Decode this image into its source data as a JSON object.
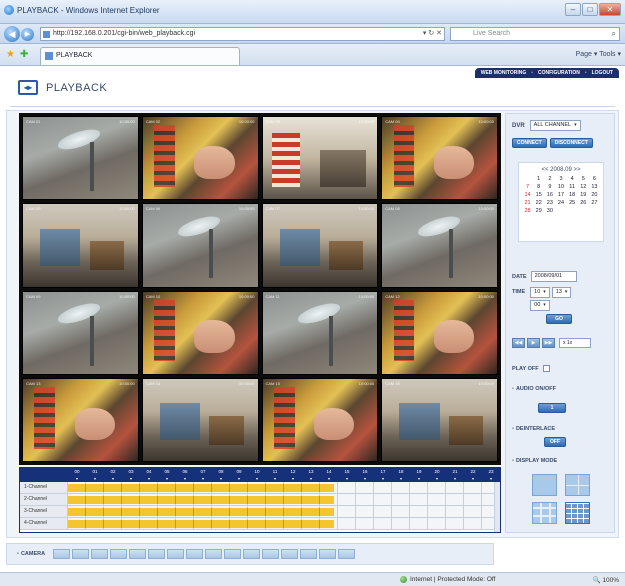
{
  "browser": {
    "window_title": "PLAYBACK - Windows Internet Explorer",
    "url": "http://192.168.0.201/cgi-bin/web_playback.cgi",
    "search_placeholder": "Live Search",
    "tab_title": "PLAYBACK",
    "tools": "Page ▾  Tools ▾",
    "status_zone": "Internet | Protected Mode: Off",
    "zoom": "100%"
  },
  "app": {
    "page_title": "PLAYBACK",
    "nav": [
      "WEB MONITORING",
      "CONFIGURATION",
      "LOGOUT"
    ]
  },
  "cameras": [
    {
      "label": "CAM 01",
      "time": "10:00:00",
      "scene": "street"
    },
    {
      "label": "CAM 02",
      "time": "10:00:00",
      "scene": "object"
    },
    {
      "label": "CAM 03",
      "time": "10:00:00",
      "scene": "store"
    },
    {
      "label": "CAM 04",
      "time": "10:00:00",
      "scene": "object"
    },
    {
      "label": "CAM 05",
      "time": "10:00:00",
      "scene": "room"
    },
    {
      "label": "CAM 06",
      "time": "10:00:00",
      "scene": "street"
    },
    {
      "label": "CAM 07",
      "time": "10:00:00",
      "scene": "room"
    },
    {
      "label": "CAM 08",
      "time": "10:00:00",
      "scene": "street"
    },
    {
      "label": "CAM 09",
      "time": "10:00:00",
      "scene": "street"
    },
    {
      "label": "CAM 10",
      "time": "10:00:00",
      "scene": "object"
    },
    {
      "label": "CAM 11",
      "time": "10:00:00",
      "scene": "street"
    },
    {
      "label": "CAM 12",
      "time": "10:00:00",
      "scene": "object"
    },
    {
      "label": "CAM 13",
      "time": "10:00:00",
      "scene": "object"
    },
    {
      "label": "CAM 14",
      "time": "10:00:00",
      "scene": "room"
    },
    {
      "label": "CAM 15",
      "time": "10:00:00",
      "scene": "object"
    },
    {
      "label": "CAM 16",
      "time": "10:00:00",
      "scene": "room"
    }
  ],
  "timeline": {
    "hours": [
      "00",
      "01",
      "02",
      "03",
      "04",
      "05",
      "06",
      "07",
      "08",
      "09",
      "10",
      "11",
      "12",
      "13",
      "14",
      "15",
      "16",
      "17",
      "18",
      "19",
      "20",
      "21",
      "22",
      "23"
    ],
    "channels": [
      {
        "name": "1-Channel",
        "recorded_fraction": 0.625
      },
      {
        "name": "2-Channel",
        "recorded_fraction": 0.625
      },
      {
        "name": "3-Channel",
        "recorded_fraction": 0.625
      },
      {
        "name": "4-Channel",
        "recorded_fraction": 0.625
      }
    ]
  },
  "panel": {
    "dvr_label": "DVR",
    "dvr_value": "ALL CHANNEL",
    "connect": "CONNECT",
    "disconnect": "DISCONNECT",
    "calendar_header": "<<  2008.09  >>",
    "calendar_days": [
      {
        "d": "",
        "red": false
      },
      {
        "d": "1",
        "red": false
      },
      {
        "d": "2",
        "red": false
      },
      {
        "d": "3",
        "red": false
      },
      {
        "d": "4",
        "red": false
      },
      {
        "d": "5",
        "red": false
      },
      {
        "d": "6",
        "red": false
      },
      {
        "d": "7",
        "red": true
      },
      {
        "d": "8",
        "red": false
      },
      {
        "d": "9",
        "red": false
      },
      {
        "d": "10",
        "red": false
      },
      {
        "d": "11",
        "red": false
      },
      {
        "d": "12",
        "red": false
      },
      {
        "d": "13",
        "red": false
      },
      {
        "d": "14",
        "red": true
      },
      {
        "d": "15",
        "red": false
      },
      {
        "d": "16",
        "red": false
      },
      {
        "d": "17",
        "red": false
      },
      {
        "d": "18",
        "red": false
      },
      {
        "d": "19",
        "red": false
      },
      {
        "d": "20",
        "red": false
      },
      {
        "d": "21",
        "red": true
      },
      {
        "d": "22",
        "red": false
      },
      {
        "d": "23",
        "red": false
      },
      {
        "d": "24",
        "red": false
      },
      {
        "d": "25",
        "red": false
      },
      {
        "d": "26",
        "red": false
      },
      {
        "d": "27",
        "red": false
      },
      {
        "d": "28",
        "red": true
      },
      {
        "d": "29",
        "red": false
      },
      {
        "d": "30",
        "red": false
      },
      {
        "d": "",
        "red": false
      },
      {
        "d": "",
        "red": false
      },
      {
        "d": "",
        "red": false
      },
      {
        "d": "",
        "red": false
      }
    ],
    "date_label": "DATE",
    "date_value": "2008/09/01",
    "time_label": "TIME",
    "hour": "10",
    "minute": "13",
    "second": "00",
    "go": "GO",
    "speed": "x 1x",
    "play_off": "PLAY OFF",
    "audio_label": "AUDIO ON/OFF",
    "audio_btn": "1",
    "deint_label": "DEINTERLACE",
    "deint_btn": "OFF",
    "display_label": "DISPLAY MODE",
    "camera_label": "CAMERA"
  },
  "colors": {
    "nav_bg": "#1c2f68",
    "record": "#f3c52f",
    "accent": "#2f6ab8"
  }
}
